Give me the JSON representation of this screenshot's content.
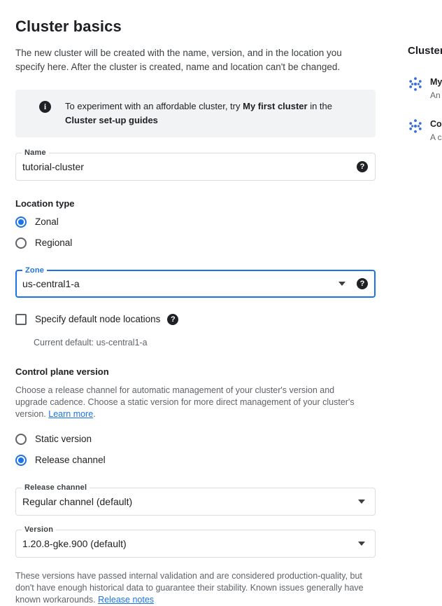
{
  "page": {
    "title": "Cluster basics",
    "description": "The new cluster will be created with the name, version, and in the location you specify here. After the cluster is created, name and location can't be changed."
  },
  "info_banner": {
    "icon": "info-icon",
    "text_part1": "To experiment with an affordable cluster, try ",
    "bold1": "My first cluster",
    "text_part2": " in the ",
    "bold2": "Cluster set-up guides"
  },
  "name_field": {
    "label": "Name",
    "value": "tutorial-cluster",
    "help_icon": "help-icon"
  },
  "location_type": {
    "heading": "Location type",
    "options": [
      {
        "label": "Zonal",
        "selected": true
      },
      {
        "label": "Regional",
        "selected": false
      }
    ]
  },
  "zone_field": {
    "label": "Zone",
    "value": "us-central1-a",
    "focused": true,
    "dropdown_icon": "chevron-down-icon",
    "help_icon": "help-icon"
  },
  "node_locations": {
    "checkbox_label": "Specify default node locations",
    "checked": false,
    "help_icon": "help-icon",
    "note": "Current default: us-central1-a"
  },
  "control_plane": {
    "heading": "Control plane version",
    "description_part1": "Choose a release channel for automatic management of your cluster's version and upgrade cadence. Choose a static version for more direct management of your cluster's version. ",
    "learn_more": "Learn more",
    "description_part2": ".",
    "options": [
      {
        "label": "Static version",
        "selected": false
      },
      {
        "label": "Release channel",
        "selected": true
      }
    ]
  },
  "release_channel_field": {
    "label": "Release channel",
    "value": "Regular channel (default)",
    "dropdown_icon": "chevron-down-icon"
  },
  "version_field": {
    "label": "Version",
    "value": "1.20.8-gke.900 (default)",
    "dropdown_icon": "chevron-down-icon"
  },
  "version_footnote": {
    "text_part1": "These versions have passed internal validation and are considered production-quality, but don't have enough historical data to guarantee their stability. Known issues generally have known workarounds. ",
    "release_notes": "Release notes"
  },
  "side_panel": {
    "title": "Cluster set-up guides",
    "items": [
      {
        "icon": "cluster-dots-icon",
        "title": "My first cluster",
        "subtitle": "An affordable cluster"
      },
      {
        "icon": "cluster-dots-icon",
        "title": "Cost-optimised cluster",
        "subtitle": "A cluster for low cost"
      }
    ]
  },
  "colors": {
    "accent": "#1a73e8",
    "text": "#202124",
    "muted": "#5f6368",
    "banner_bg": "#f1f3f4",
    "border": "#dadce0"
  }
}
